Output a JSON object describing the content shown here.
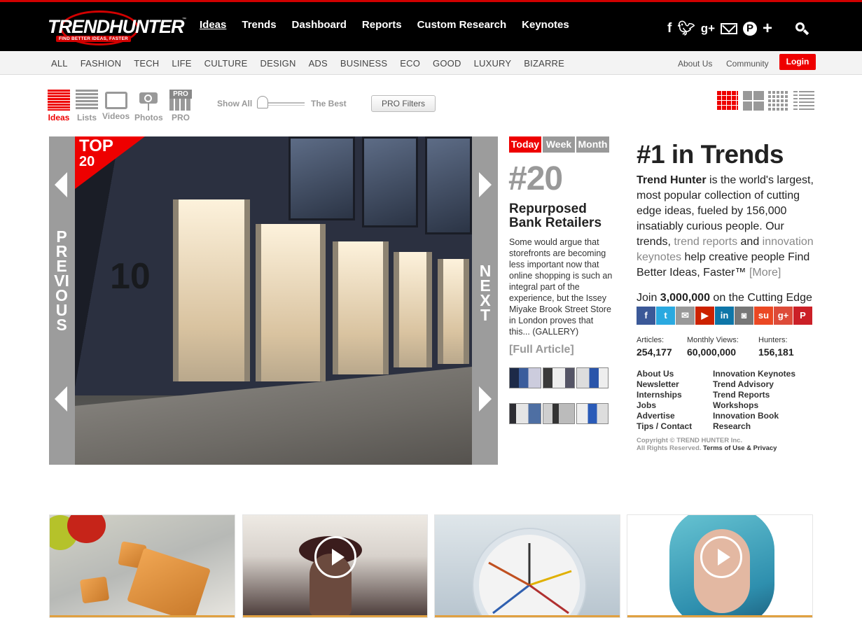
{
  "header": {
    "logo": {
      "brand": "TRENDHUNTER",
      "tagline": "FIND BETTER IDEAS, FASTER"
    },
    "nav": [
      "Ideas",
      "Trends",
      "Dashboard",
      "Reports",
      "Custom Research",
      "Keynotes"
    ],
    "social_icons": [
      "facebook-icon",
      "twitter-icon",
      "google-plus-icon",
      "mail-icon",
      "pinterest-icon",
      "plus-icon"
    ],
    "search_icon": "search-icon"
  },
  "categories": [
    "ALL",
    "FASHION",
    "TECH",
    "LIFE",
    "CULTURE",
    "DESIGN",
    "ADS",
    "BUSINESS",
    "ECO",
    "GOOD",
    "LUXURY",
    "BIZARRE"
  ],
  "utility": {
    "about": "About Us",
    "community": "Community",
    "login": "Login"
  },
  "filters": {
    "types": [
      "Ideas",
      "Lists",
      "Videos",
      "Photos",
      "PRO"
    ],
    "pro_badge": "PRO",
    "show_all": "Show All",
    "the_best": "The Best",
    "slider_level": 0,
    "pro_filters": "PRO Filters"
  },
  "hero": {
    "badge_top": "TOP",
    "badge_num": "20",
    "previous": "PREVIOUS",
    "next": "NEXT",
    "door_number": "10"
  },
  "article": {
    "tabs": [
      "Today",
      "Week",
      "Month"
    ],
    "rank": "#20",
    "title": "Repurposed Bank Retailers",
    "body": "Some would argue that storefronts are becoming less important now that online shopping is such an integral part of the experience, but the Issey Miyake Brook Street Store in London proves that this... (GALLERY)",
    "full_article": "[Full Article]"
  },
  "sidebar": {
    "title": "#1 in Trends",
    "about_brand": "Trend Hunter",
    "about_1": " is the world's largest, most popular collection of cutting edge ideas, fueled by 156,000 insatiably curious people. Our trends, ",
    "link_reports": "trend reports",
    "about_2": " and ",
    "link_keynotes": "innovation keynotes",
    "about_3": " help creative people Find Better Ideas, Faster™ ",
    "link_more": "[More]",
    "join_prefix": "Join ",
    "join_count": "3,000,000",
    "join_suffix": " on the Cutting Edge",
    "social": [
      {
        "icon": "facebook-icon",
        "glyph": "f",
        "color": "#3b5998"
      },
      {
        "icon": "twitter-icon",
        "glyph": "t",
        "color": "#2aa9e0"
      },
      {
        "icon": "mail-icon",
        "glyph": "✉",
        "color": "#999999"
      },
      {
        "icon": "youtube-icon",
        "glyph": "▶",
        "color": "#cc2200"
      },
      {
        "icon": "linkedin-icon",
        "glyph": "in",
        "color": "#0e76a8"
      },
      {
        "icon": "instagram-icon",
        "glyph": "◙",
        "color": "#777777"
      },
      {
        "icon": "stumbleupon-icon",
        "glyph": "su",
        "color": "#eb4823"
      },
      {
        "icon": "google-plus-icon",
        "glyph": "g+",
        "color": "#dd4b39"
      },
      {
        "icon": "pinterest-icon",
        "glyph": "P",
        "color": "#cb2027"
      }
    ],
    "stats": [
      {
        "label": "Articles:",
        "value": "254,177"
      },
      {
        "label": "Monthly Views:",
        "value": "60,000,000"
      },
      {
        "label": "Hunters:",
        "value": "156,181"
      }
    ],
    "links_left": [
      "About Us",
      "Newsletter",
      "Internships",
      "Jobs",
      "Advertise",
      "Tips / Contact"
    ],
    "links_right": [
      "Innovation Keynotes",
      "Trend Advisory",
      "Trend Reports",
      "Workshops",
      "Innovation Book",
      "Research"
    ],
    "copyright": "Copyright © TREND HUNTER Inc.",
    "rights": "All Rights Reserved. ",
    "terms": "Terms of Use & Privacy"
  }
}
